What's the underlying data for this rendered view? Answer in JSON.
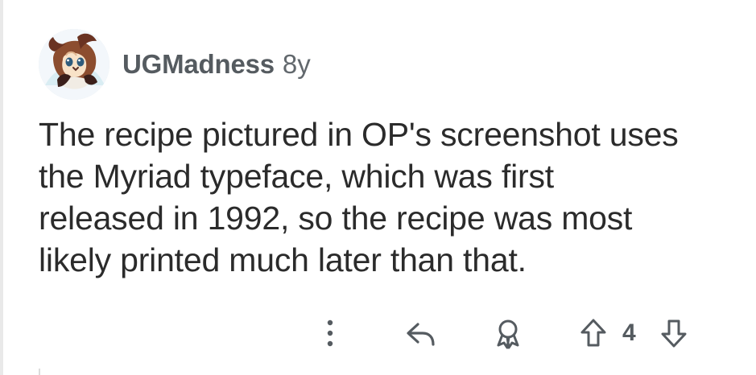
{
  "comment": {
    "author": "UGMadness",
    "age": "8y",
    "body_lines": [
      "The recipe pictured in OP's screenshot uses",
      "the Myriad typeface, which was first",
      "released in 1992, so the recipe was most",
      "likely printed much later than that."
    ],
    "score": "4",
    "avatar": "avatar",
    "icons": {
      "more": "more-options-icon",
      "reply": "reply-icon",
      "award": "award-icon",
      "upvote": "upvote-arrow-icon",
      "downvote": "downvote-arrow-icon"
    }
  }
}
